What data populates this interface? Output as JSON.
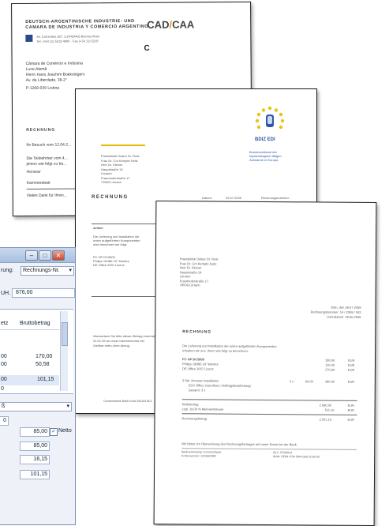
{
  "doc1": {
    "header_line1": "DEUTSCH-ARGENTINISCHE INDUSTRIE- UND",
    "header_line2": "CAMARA DE INDUSTRIA Y COMERCIO ARGENTINO-",
    "logo_text": "CAD",
    "logo_text2": "CAA",
    "letter_c": "C",
    "addr1": "Av. Corrientes 327, C1043AAD Buenos Aires",
    "addr2": "Tel. (+54 11) 5219 4000 · Fax (+54 11) 5219",
    "recipient1": "Câmara de Comércio e Indústria",
    "recipient2": "Luso-Alemã",
    "recipient3": "Herrn Hans Joachim Boekstegers",
    "recipient4": "Av. da Liberdade, 38-2°",
    "recipient5": "P-1269-039 Lisboa",
    "section": "RECHNUNG",
    "body1": "Ihr Besuch vom 12.04.2...",
    "body2": "Die Teilnehmer vom 4...",
    "body3": "pinion wie folgt zu ba...",
    "item1": "Honorar",
    "item2": "Kammerabatt",
    "footer": "Vielen Dank für Ihren..."
  },
  "doc2": {
    "logo": "BDIZ EDI",
    "sender1": "Bundesverband der",
    "sender2": "implantologisch tätigen",
    "sender3": "Zahnärzte in Europa",
    "address": [
      "Praxisklinik Doktor Dr. Rost",
      "Frau Dr. Cm Kempfe Seitz",
      "Herr Dr. Kleiner",
      "Hauptstraße 19",
      "Lörrach",
      "Fraunhoferstraße 17",
      "79539 Lörrach"
    ],
    "title": "RECHNUNG",
    "date_label": "Datum:",
    "date_value": "29.07.2009",
    "right_label": "Rechnungsnummer:",
    "article_header": "Artikel",
    "article_text1": "Die Lieferung und Installation der",
    "article_text2": "unten aufgeführten Komponenten",
    "article_text3": "wird berechnet wie folgt:",
    "product1": "PC HP DC5800",
    "product2": "Philips 190B6 19\" Monitor",
    "product3": "DE Office 2007 Lizenz",
    "note1": "Überweisen Sie bitte diesen Betrag innerhalb",
    "note2": "31.01.09 an unser Kammerkonto bei",
    "note3": "Zahlbar netto ohne Abzug.",
    "footer": "Commerzbank Bank Konto 501164 BLZ"
  },
  "doc3": {
    "address": [
      "Praxisklinik Doktor Dr. Rost",
      "Frau Dr. Cm Kempfe Seitz",
      "Herr Dr. Kleiner",
      "Hauptstraße 19",
      "Lörrach",
      "Fraunhoferstraße 17",
      "79539 Lörrach"
    ],
    "date_line": "Köln, den 29.07.2009",
    "invoice_line": "Rechnungsnummer: 14 / 2009 / 002",
    "delivery_line": "Lieferdatum: 29.06.2009",
    "title": "RECHNUNG",
    "intro1": "Die Lieferung und Installation der unten aufgeführten Komponenten",
    "intro2": "erlauben wir uns, Ihnen wie folgt zu berechnen:",
    "rows": [
      {
        "desc": "PC HP DC5800",
        "amount": "180,00",
        "cur": "EUR"
      },
      {
        "desc": "Philips 190B6 19\" Monitor",
        "amount": "110,00",
        "cur": "EUR"
      },
      {
        "desc": "DE Office 2007 Lizenz",
        "amount": "170,00",
        "cur": "EUR"
      }
    ],
    "service1": "3 Std. Honorar Installation",
    "service1_qty": "3 x",
    "service1_rate": "60,00",
    "service1_amount": "180,00",
    "service1_cur": "EUR",
    "service2": "EDV Office Grundkurs / Auftragsbearbeitung:",
    "service3": "Gesamt: 3 x",
    "net_label": "Nettobetrag",
    "net_value": "2.690,00",
    "net_cur": "EUR",
    "vat_label": "zzgl. 19,00 % Mehrwertsteuer",
    "vat_value": "511,10",
    "vat_cur": "EUR",
    "gross_label": "Rechnungsbetrag",
    "gross_value": "3.201,10",
    "gross_cur": "EUR",
    "note": "Wir bitten um Überweisung des Rechnungsbetrages auf unser Konto bei der Bank.",
    "footer_l1": "Bankverbindung:   Commerzbank",
    "footer_l2": "Kontonummer:     1234567890",
    "footer_r1": "BLZ:   37040044",
    "footer_r2": "IBAN:  DE89 3704 0044 0532 0130 00"
  },
  "window": {
    "search_label": "rung:",
    "search_value": "Rechnungs-Nr.",
    "uh_label": "UH.",
    "uh_value": "876,00",
    "col1": "etz",
    "col2": "Bruttobetrag",
    "rows": [
      {
        "left": "00",
        "right": "170,00"
      },
      {
        "left": "00",
        "right": "50,58"
      },
      {
        "left": "00",
        "right": "101,15"
      },
      {
        "left": "0",
        "right": ""
      }
    ],
    "detail_label": "ß",
    "val1": "85,00",
    "netto_label": "Netto",
    "val2": "85,00",
    "val3": "16,15",
    "val4": "101,15"
  }
}
